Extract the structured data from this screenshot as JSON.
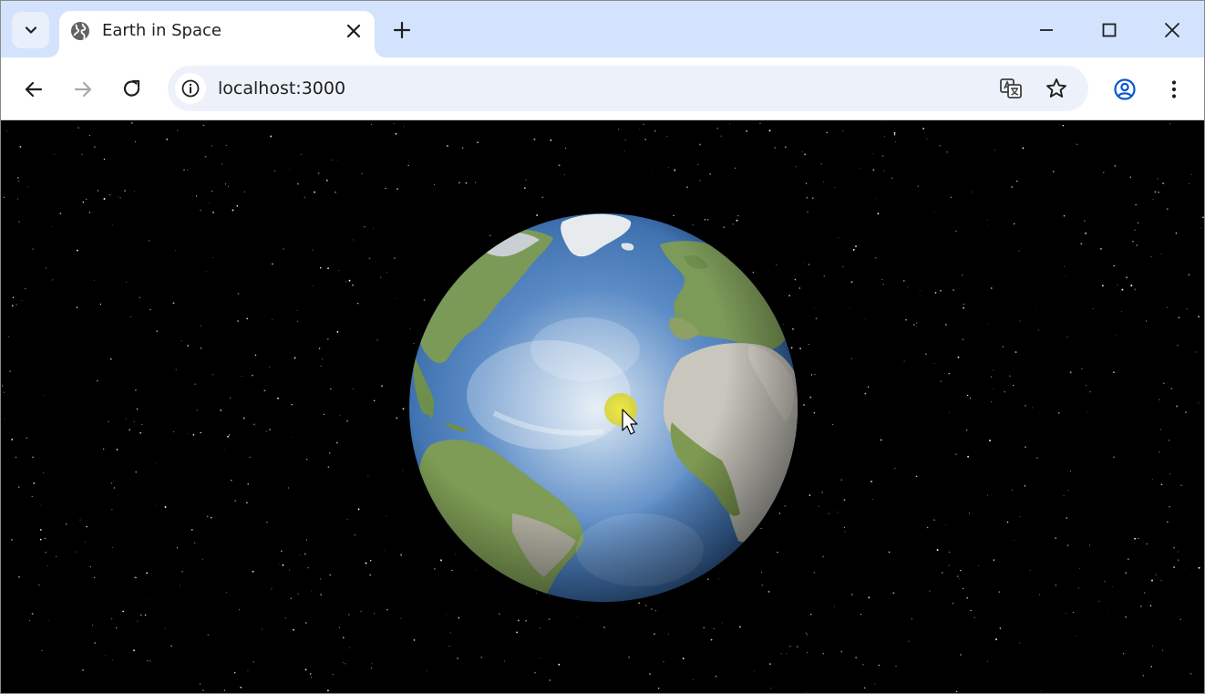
{
  "browser": {
    "tab": {
      "title": "Earth in Space",
      "favicon": "globe-icon"
    },
    "address": {
      "url": "localhost:3000"
    },
    "icons": {
      "tab_search": "chevron-down-icon",
      "tab_close": "close-icon",
      "new_tab": "plus-icon",
      "minimize": "minimize-icon",
      "maximize": "maximize-icon",
      "close_window": "close-icon",
      "back": "arrow-left-icon",
      "forward": "arrow-right-icon",
      "reload": "reload-icon",
      "site_info": "info-icon",
      "translate": "translate-icon",
      "bookmark": "star-icon",
      "profile": "profile-icon",
      "menu": "more-vertical-icon"
    }
  },
  "scene": {
    "background": "#000000",
    "subject": "earth-globe",
    "cursor_highlight_color": "#e8e23a"
  },
  "colors": {
    "tabstrip": "#d3e3fd",
    "toolbar": "#ffffff",
    "omnibox": "#edf2fa",
    "ocean": "#4f7fb8",
    "land": "#7a9a55"
  }
}
